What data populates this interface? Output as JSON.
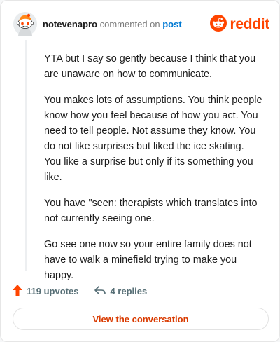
{
  "header": {
    "username": "notevenapro",
    "action": " commented on ",
    "post_link": "post",
    "brand": "reddit"
  },
  "comment": {
    "paragraphs": [
      "YTA but I say so gently because I think that you are unaware on how to communicate.",
      "You makes lots of assumptions. You think people know how you feel because of how you act. You need to tell people. Not assume they know. You do not like surprises but liked the ice skating. You like a surprise but only if its something you like.",
      "You have \"seen: therapists which translates into not currently seeing one.",
      "Go see one now so your entire family does not have to walk a minefield trying to make you happy."
    ]
  },
  "actions": {
    "upvotes": "119 upvotes",
    "replies": "4 replies"
  },
  "cta": {
    "label": "View the conversation"
  },
  "colors": {
    "brand": "#ff4500",
    "link": "#0079d3",
    "cta_text": "#d93a00"
  },
  "icons": {
    "avatar": "snoo-avatar-icon",
    "logo": "reddit-logo-icon",
    "upvote": "upvote-arrow-icon",
    "reply": "reply-arrow-icon"
  }
}
